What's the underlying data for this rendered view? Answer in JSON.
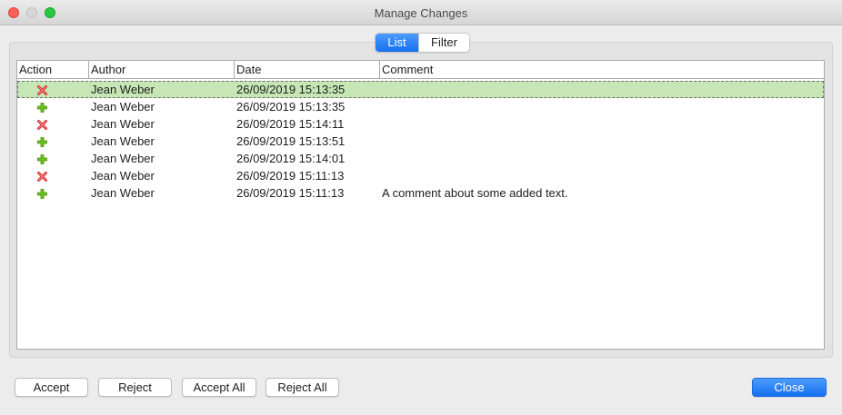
{
  "window": {
    "title": "Manage Changes"
  },
  "tabs": {
    "list_label": "List",
    "filter_label": "Filter",
    "active": "List"
  },
  "table": {
    "columns": [
      "Action",
      "Author",
      "Date",
      "Comment"
    ],
    "rows": [
      {
        "action_icon": "delete-icon",
        "author": "Jean Weber",
        "date": "26/09/2019 15:13:35",
        "comment": "",
        "selected": true
      },
      {
        "action_icon": "insert-icon",
        "author": "Jean Weber",
        "date": "26/09/2019 15:13:35",
        "comment": ""
      },
      {
        "action_icon": "delete-icon",
        "author": "Jean Weber",
        "date": "26/09/2019 15:14:11",
        "comment": ""
      },
      {
        "action_icon": "insert-icon",
        "author": "Jean Weber",
        "date": "26/09/2019 15:13:51",
        "comment": ""
      },
      {
        "action_icon": "insert-icon",
        "author": "Jean Weber",
        "date": "26/09/2019 15:14:01",
        "comment": ""
      },
      {
        "action_icon": "delete-icon",
        "author": "Jean Weber",
        "date": "26/09/2019 15:11:13",
        "comment": ""
      },
      {
        "action_icon": "insert-icon",
        "author": "Jean Weber",
        "date": "26/09/2019 15:11:13",
        "comment": "A comment about some added text."
      }
    ]
  },
  "buttons": {
    "accept": "Accept",
    "reject": "Reject",
    "accept_all": "Accept All",
    "reject_all": "Reject All",
    "close": "Close"
  },
  "colors": {
    "selected_row": "#c6e6b5",
    "accent": "#1570ef",
    "delete_icon": "#d62b2b",
    "insert_icon": "#6cc21b"
  }
}
